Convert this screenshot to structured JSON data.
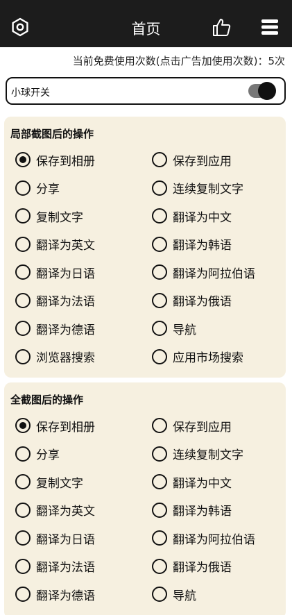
{
  "header": {
    "title": "首页",
    "settings_icon": "settings-icon",
    "like_icon": "thumbs-up-icon",
    "menu_icon": "menu-icon"
  },
  "usage_text": "当前免费使用次数(点击广告加使用次数)：5次",
  "ball_switch": {
    "label": "小球开关",
    "on": true
  },
  "sections": [
    {
      "title": "局部截图后的操作",
      "selected": 0,
      "options": [
        "保存到相册",
        "保存到应用",
        "分享",
        "连续复制文字",
        "复制文字",
        "翻译为中文",
        "翻译为英文",
        "翻译为韩语",
        "翻译为日语",
        "翻译为阿拉伯语",
        "翻译为法语",
        "翻译为俄语",
        "翻译为德语",
        "导航",
        "浏览器搜索",
        "应用市场搜索"
      ]
    },
    {
      "title": "全截图后的操作",
      "selected": 0,
      "options": [
        "保存到相册",
        "保存到应用",
        "分享",
        "连续复制文字",
        "复制文字",
        "翻译为中文",
        "翻译为英文",
        "翻译为韩语",
        "翻译为日语",
        "翻译为阿拉伯语",
        "翻译为法语",
        "翻译为俄语",
        "翻译为德语",
        "导航"
      ]
    }
  ],
  "colors": {
    "header_bg": "#1c1c1c",
    "panel_bg": "#f6f0e0",
    "toggle_track": "#777777",
    "toggle_knob": "#111111"
  }
}
